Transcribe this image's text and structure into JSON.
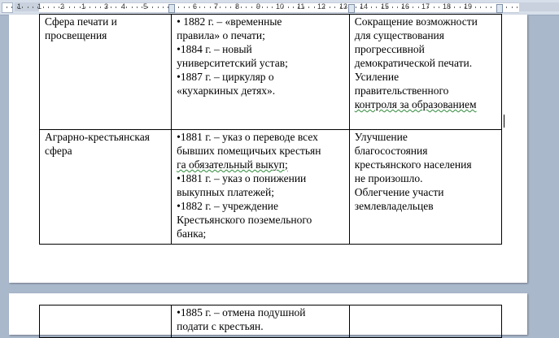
{
  "ruler": {
    "left_numbers": [
      "1",
      "1",
      "2",
      "1",
      "3",
      "4",
      "5"
    ],
    "numbers": [
      "6",
      "7",
      "8",
      "9",
      "10",
      "11",
      "12",
      "13",
      "14",
      "15",
      "16",
      "17",
      "18",
      "19"
    ]
  },
  "table": {
    "rows": [
      {
        "sphere": [
          "Сфера печати и",
          "просвещения"
        ],
        "measures": [
          [
            "• 1882 г. – «временные",
            "правила» о печати;"
          ],
          [
            "•1884 г. – новый",
            "университетский устав;"
          ],
          [
            "•1887 г. – циркуляр о",
            "«кухаркиных детях»."
          ]
        ],
        "results": [
          [
            "Сокращение возможности",
            "для существования",
            "прогрессивной",
            "демократической печати."
          ],
          [
            "Усиление",
            "правительственного",
            "контроля за образованием"
          ]
        ]
      },
      {
        "sphere": [
          "Аграрно-крестьянская",
          "сфера"
        ],
        "measures": [
          [
            "•1881 г. – указ о переводе всех",
            "бывших помещичьих крестьян",
            "га обязательный выкуп;"
          ],
          [
            "•1881 г. – указ о понижении",
            "выкупных платежей;"
          ],
          [
            "•1882 г. – учреждение",
            "Крестьянского поземельного",
            "банка;"
          ]
        ],
        "results": [
          [
            "Улучшение",
            "благосостояния",
            "крестьянского населения",
            "не произошло."
          ],
          [
            "Облегчение участи",
            "землевладельцев"
          ]
        ]
      }
    ],
    "continuation": {
      "measures": [
        "•1885 г. – отмена подушной",
        "подати с крестьян."
      ]
    }
  }
}
